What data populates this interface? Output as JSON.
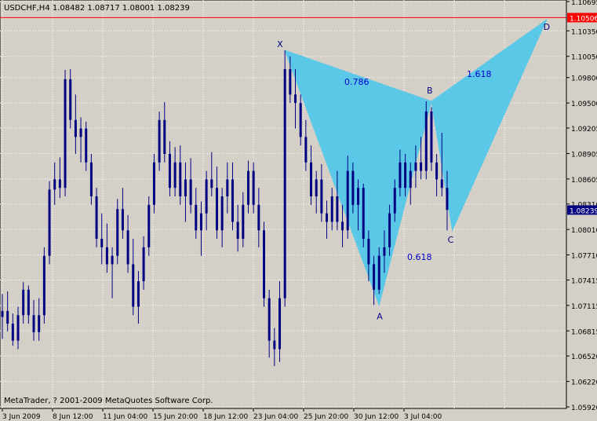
{
  "header": {
    "symbol_line": "USDCHF,H4  1.08482 1.08717 1.08001 1.08239"
  },
  "footer": {
    "copyright": "MetaTrader, ? 2001-2009 MetaQuotes Software Corp."
  },
  "colors": {
    "background": "#d4d0c8",
    "plot_bg": "#d4d0c8",
    "grid": "#ffffff",
    "candles": "#000080",
    "pattern_fill": "#5cc8e8",
    "pattern_stroke": "#5cc8e8",
    "hline": "#ff0000",
    "current_price_bg": "#000080",
    "hline_label_bg": "#ff0000",
    "pattern_text": "#0000c8"
  },
  "chart_data": {
    "type": "candlestick",
    "y_ticks": [
      "1.10695",
      "1.10350",
      "1.10005",
      "1.09660",
      "1.09315",
      "1.08970",
      "1.08625",
      "1.08280",
      "1.07935",
      "1.07590",
      "1.07245",
      "1.06900",
      "1.06555",
      "1.06210",
      "1.05865"
    ],
    "y_axis_labels": [
      "1.10695",
      "1.10350",
      "1.10050",
      "1.09800",
      "1.09500",
      "1.09205",
      "1.08905",
      "1.08605",
      "1.08310",
      "1.08010",
      "1.07710",
      "1.07415",
      "1.07115",
      "1.06815",
      "1.06520",
      "1.06220",
      "1.05920"
    ],
    "ylim": [
      1.0592,
      1.10695
    ],
    "x_tick_labels": [
      "3 Jun 2009",
      "8 Jun 12:00",
      "11 Jun 04:00",
      "15 Jun 20:00",
      "18 Jun 12:00",
      "23 Jun 04:00",
      "25 Jun 20:00",
      "30 Jun 12:00",
      "3 Jul 04:00"
    ],
    "horizontal_line": {
      "value": 1.10506,
      "label": "1.10506"
    },
    "current_price": {
      "value": 1.08239,
      "label": "1.08239"
    },
    "pattern": {
      "name": "butterfly",
      "points": [
        {
          "label": "X",
          "bar": 54,
          "price": 1.1012
        },
        {
          "label": "A",
          "bar": 72,
          "price": 1.0712
        },
        {
          "label": "B",
          "bar": 82,
          "price": 1.0952
        },
        {
          "label": "C",
          "bar": 86,
          "price": 1.08
        },
        {
          "label": "D",
          "bar": 104,
          "price": 1.1048
        }
      ],
      "ratios": [
        {
          "text": "0.786",
          "near": "XB"
        },
        {
          "text": "0.618",
          "near": "AC"
        },
        {
          "text": "1.618",
          "near": "BD"
        }
      ]
    },
    "candles": [
      [
        1.0698,
        1.0725,
        1.0672,
        1.0705
      ],
      [
        1.0705,
        1.0728,
        1.0681,
        1.069
      ],
      [
        1.069,
        1.0702,
        1.0664,
        1.067
      ],
      [
        1.067,
        1.071,
        1.066,
        1.07
      ],
      [
        1.07,
        1.0739,
        1.069,
        1.073
      ],
      [
        1.073,
        1.0735,
        1.069,
        1.07
      ],
      [
        1.07,
        1.0718,
        1.067,
        1.068
      ],
      [
        1.068,
        1.072,
        1.067,
        1.07
      ],
      [
        1.07,
        1.078,
        1.069,
        1.077
      ],
      [
        1.077,
        1.0858,
        1.076,
        1.0848
      ],
      [
        1.0848,
        1.088,
        1.083,
        1.086
      ],
      [
        1.086,
        1.0886,
        1.0838,
        1.085
      ],
      [
        1.085,
        1.0989,
        1.084,
        1.0978
      ],
      [
        1.0978,
        1.099,
        1.092,
        1.093
      ],
      [
        1.093,
        1.096,
        1.089,
        1.091
      ],
      [
        1.091,
        1.0933,
        1.088,
        1.092
      ],
      [
        1.092,
        1.0928,
        1.087,
        1.088
      ],
      [
        1.088,
        1.089,
        1.083,
        1.084
      ],
      [
        1.084,
        1.085,
        1.078,
        1.079
      ],
      [
        1.079,
        1.082,
        1.076,
        1.078
      ],
      [
        1.078,
        1.0808,
        1.075,
        1.076
      ],
      [
        1.076,
        1.078,
        1.072,
        1.077
      ],
      [
        1.077,
        1.0837,
        1.076,
        1.0825
      ],
      [
        1.0825,
        1.085,
        1.079,
        1.08
      ],
      [
        1.08,
        1.0818,
        1.075,
        1.076
      ],
      [
        1.076,
        1.079,
        1.07,
        1.071
      ],
      [
        1.071,
        1.0752,
        1.069,
        1.074
      ],
      [
        1.074,
        1.0793,
        1.073,
        1.078
      ],
      [
        1.078,
        1.084,
        1.077,
        1.083
      ],
      [
        1.083,
        1.089,
        1.082,
        1.088
      ],
      [
        1.088,
        1.094,
        1.087,
        1.093
      ],
      [
        1.093,
        1.0951,
        1.088,
        1.089
      ],
      [
        1.089,
        1.0905,
        1.084,
        1.085
      ],
      [
        1.085,
        1.0898,
        1.084,
        1.088
      ],
      [
        1.088,
        1.09,
        1.083,
        1.084
      ],
      [
        1.084,
        1.088,
        1.081,
        1.086
      ],
      [
        1.086,
        1.0885,
        1.082,
        1.083
      ],
      [
        1.083,
        1.085,
        1.079,
        1.08
      ],
      [
        1.08,
        1.0834,
        1.077,
        1.082
      ],
      [
        1.082,
        1.087,
        1.08,
        1.086
      ],
      [
        1.086,
        1.0892,
        1.084,
        1.085
      ],
      [
        1.085,
        1.0875,
        1.079,
        1.08
      ],
      [
        1.08,
        1.085,
        1.078,
        1.084
      ],
      [
        1.084,
        1.088,
        1.082,
        1.086
      ],
      [
        1.086,
        1.088,
        1.08,
        1.081
      ],
      [
        1.081,
        1.083,
        1.0775,
        1.079
      ],
      [
        1.079,
        1.0845,
        1.078,
        1.083
      ],
      [
        1.083,
        1.0882,
        1.082,
        1.087
      ],
      [
        1.087,
        1.088,
        1.082,
        1.083
      ],
      [
        1.083,
        1.085,
        1.078,
        1.08
      ],
      [
        1.08,
        1.081,
        1.071,
        1.072
      ],
      [
        1.072,
        1.073,
        1.065,
        1.067
      ],
      [
        1.067,
        1.0685,
        1.064,
        1.066
      ],
      [
        1.066,
        1.074,
        1.0645,
        1.072
      ],
      [
        1.072,
        1.1012,
        1.071,
        1.099
      ],
      [
        1.099,
        1.1005,
        1.095,
        1.096
      ],
      [
        1.096,
        1.099,
        1.092,
        1.095
      ],
      [
        1.095,
        1.096,
        1.09,
        1.091
      ],
      [
        1.091,
        1.093,
        1.087,
        1.088
      ],
      [
        1.088,
        1.09,
        1.083,
        1.084
      ],
      [
        1.084,
        1.087,
        1.082,
        1.086
      ],
      [
        1.086,
        1.0878,
        1.081,
        1.082
      ],
      [
        1.082,
        1.0835,
        1.079,
        1.081
      ],
      [
        1.081,
        1.085,
        1.08,
        1.084
      ],
      [
        1.084,
        1.087,
        1.08,
        1.081
      ],
      [
        1.081,
        1.083,
        1.078,
        1.08
      ],
      [
        1.08,
        1.0888,
        1.079,
        1.087
      ],
      [
        1.087,
        1.088,
        1.082,
        1.083
      ],
      [
        1.083,
        1.086,
        1.08,
        1.085
      ],
      [
        1.085,
        1.0855,
        1.078,
        1.079
      ],
      [
        1.079,
        1.08,
        1.074,
        1.076
      ],
      [
        1.076,
        1.077,
        1.0712,
        1.073
      ],
      [
        1.073,
        1.078,
        1.0725,
        1.077
      ],
      [
        1.077,
        1.08,
        1.075,
        1.078
      ],
      [
        1.078,
        1.083,
        1.077,
        1.082
      ],
      [
        1.082,
        1.086,
        1.081,
        1.085
      ],
      [
        1.085,
        1.0895,
        1.084,
        1.088
      ],
      [
        1.088,
        1.089,
        1.084,
        1.085
      ],
      [
        1.085,
        1.088,
        1.083,
        1.087
      ],
      [
        1.087,
        1.09,
        1.085,
        1.088
      ],
      [
        1.088,
        1.091,
        1.086,
        1.087
      ],
      [
        1.087,
        1.0952,
        1.086,
        1.094
      ],
      [
        1.094,
        1.0945,
        1.087,
        1.088
      ],
      [
        1.088,
        1.089,
        1.084,
        1.086
      ],
      [
        1.086,
        1.0915,
        1.084,
        1.085
      ],
      [
        1.085,
        1.087,
        1.08,
        1.0824
      ]
    ]
  }
}
